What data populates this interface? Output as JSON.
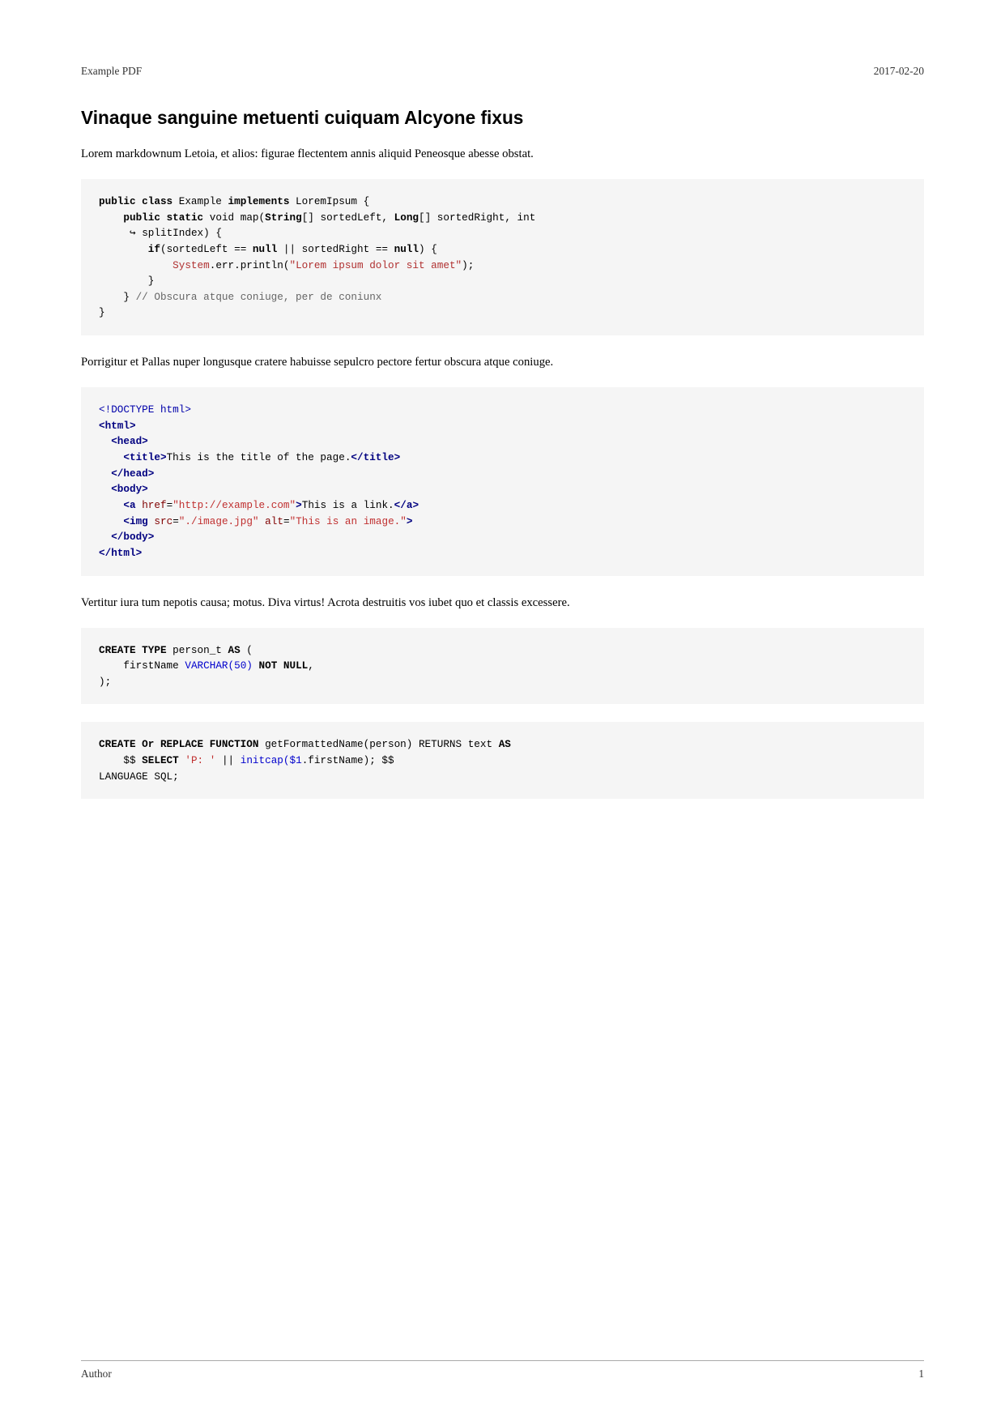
{
  "header": {
    "left": "Example PDF",
    "right": "2017-02-20"
  },
  "section": {
    "title": "Vinaque sanguine metuenti cuiquam Alcyone fixus"
  },
  "paragraph1": "Lorem markdownum Letoia, et alios: figurae flectentem annis aliquid Peneosque abesse obstat.",
  "paragraph2": "Porrigitur et Pallas nuper longusque cratere habuisse sepulcro pectore fertur obscura atque coniuge.",
  "paragraph3": "Vertitur iura tum nepotis causa; motus. Diva virtus! Acrota destruitis vos iubet quo et classis excessere.",
  "footer": {
    "left": "Author",
    "right": "1"
  }
}
